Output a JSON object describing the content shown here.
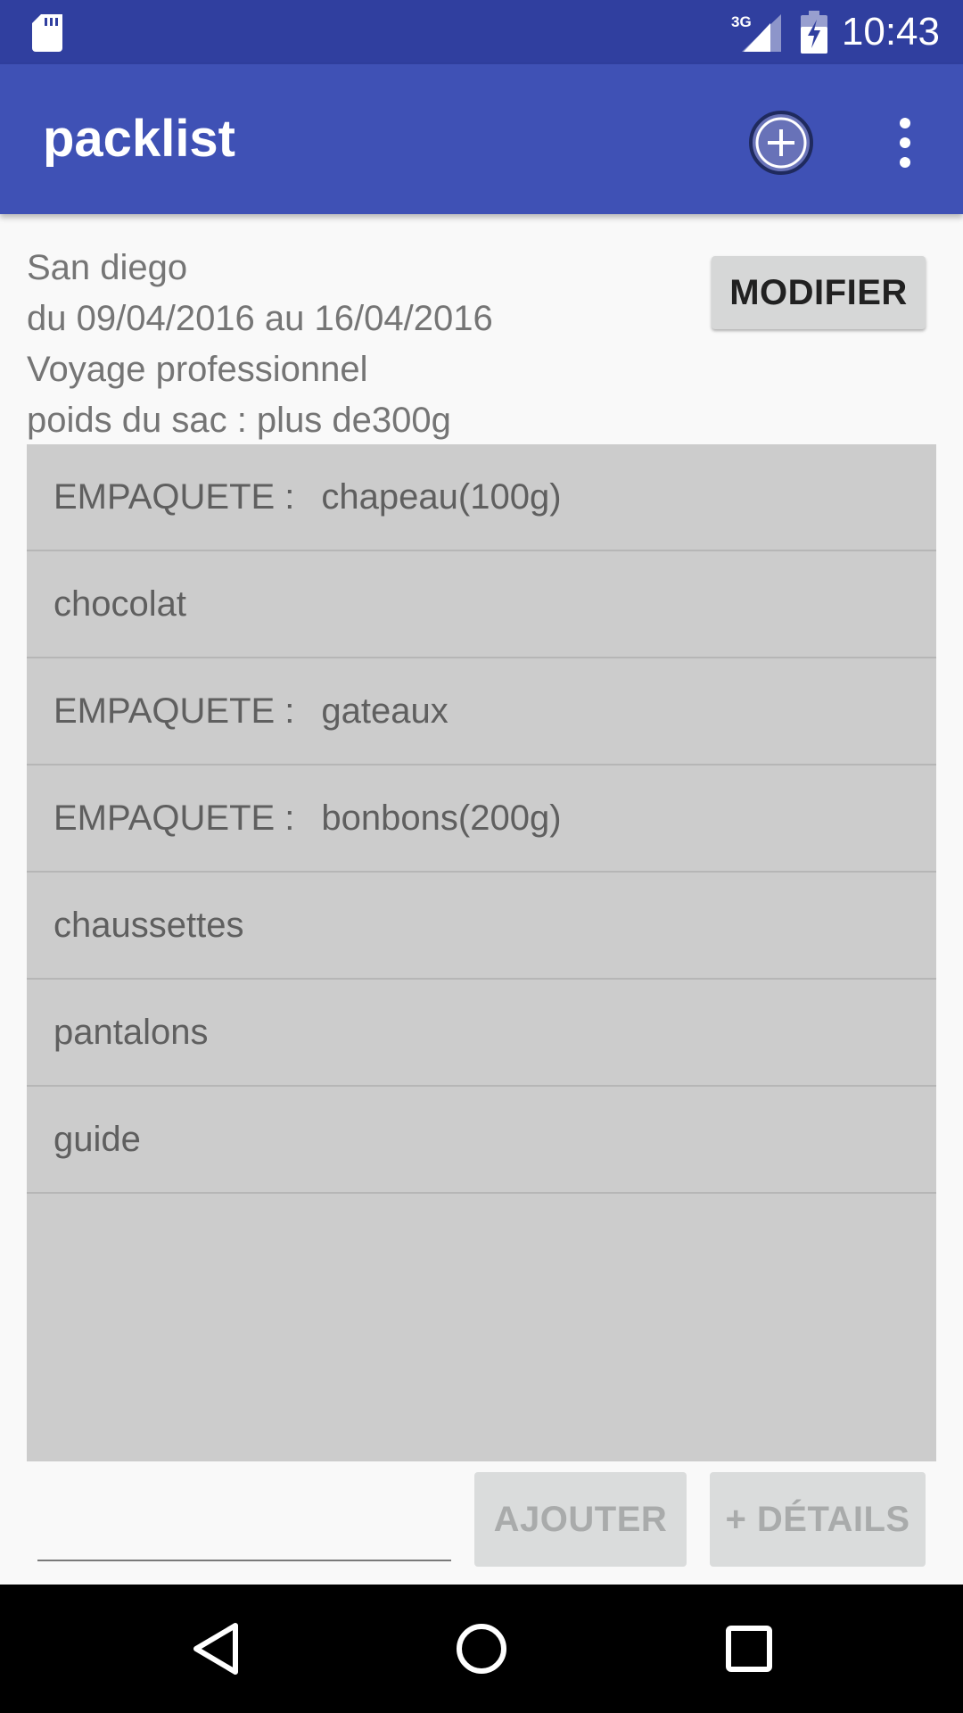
{
  "status_bar": {
    "time": "10:43",
    "network": "3G",
    "icons": [
      "sd-card-icon",
      "signal-icon",
      "battery-charging-icon"
    ]
  },
  "app_bar": {
    "title": "packlist",
    "actions": [
      "add-circle-icon",
      "more-vert-icon"
    ]
  },
  "trip": {
    "destination": "San diego",
    "dates": "du 09/04/2016 au 16/04/2016",
    "type": "Voyage professionnel",
    "bag_weight": "poids du sac : plus de300g",
    "modify_label": "MODIFIER"
  },
  "items": [
    {
      "prefix": "EMPAQUETE :",
      "name": "chapeau(100g)"
    },
    {
      "prefix": "",
      "name": "chocolat"
    },
    {
      "prefix": "EMPAQUETE :",
      "name": "gateaux"
    },
    {
      "prefix": "EMPAQUETE :",
      "name": "bonbons(200g)"
    },
    {
      "prefix": "",
      "name": "chaussettes"
    },
    {
      "prefix": "",
      "name": "pantalons"
    },
    {
      "prefix": "",
      "name": "guide"
    }
  ],
  "bottom": {
    "input_value": "",
    "add_label": "AJOUTER",
    "details_label": "+ DÉTAILS"
  },
  "nav_bar": {
    "icons": [
      "back-icon",
      "home-icon",
      "recents-icon"
    ]
  },
  "colors": {
    "status_bar": "#303f9f",
    "app_bar": "#3f51b5",
    "list_background": "#cccccc"
  }
}
